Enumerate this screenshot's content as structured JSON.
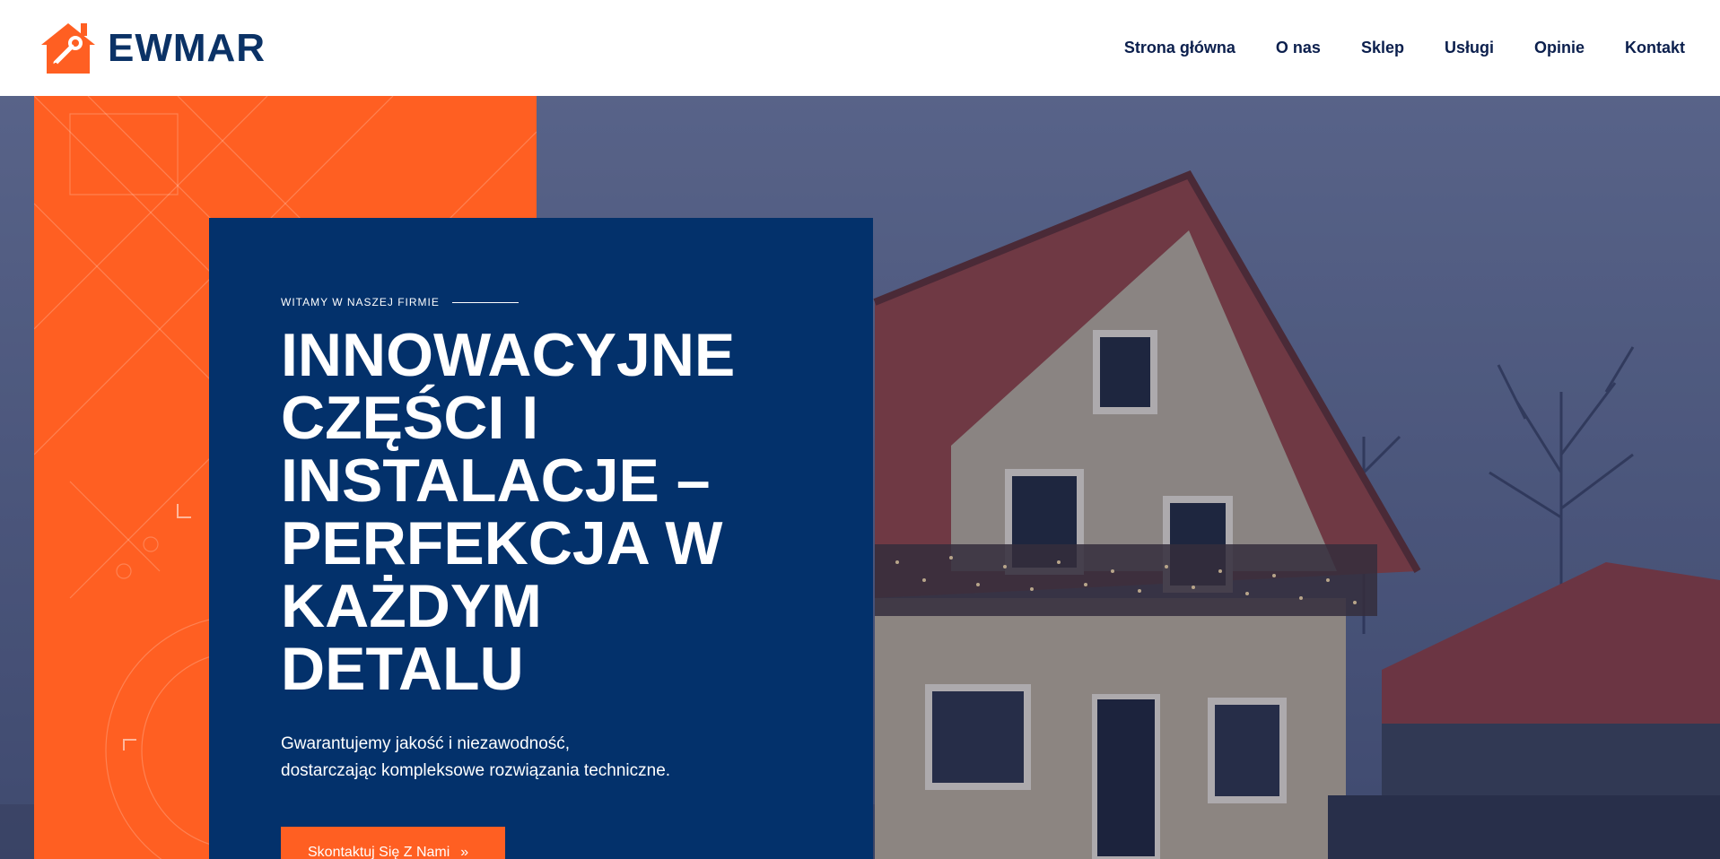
{
  "brand": {
    "name": "EWMAR",
    "logo_icon": "house-wrench-icon",
    "colors": {
      "orange": "#ff5f22",
      "navy": "#03316b",
      "text_dark": "#0b1f4d"
    }
  },
  "nav": {
    "items": [
      {
        "label": "Strona główna"
      },
      {
        "label": "O nas"
      },
      {
        "label": "Sklep"
      },
      {
        "label": "Usługi"
      },
      {
        "label": "Opinie"
      },
      {
        "label": "Kontakt"
      }
    ]
  },
  "hero": {
    "eyebrow": "WITAMY W NASZEJ FIRMIE",
    "headline_lines": [
      "INNOWACYJNE",
      "CZĘŚCI I",
      "INSTALACJE –",
      "PERFEKCJA W",
      "KAŻDYM",
      "DETALU"
    ],
    "subtitle_lines": [
      "Gwarantujemy jakość i niezawodność,",
      "dostarczając kompleksowe rozwiązania techniczne."
    ],
    "cta_label": "Skontaktuj Się Z Nami",
    "cta_icon": "double-chevron-right-icon",
    "photo_icon": "house-photo"
  }
}
